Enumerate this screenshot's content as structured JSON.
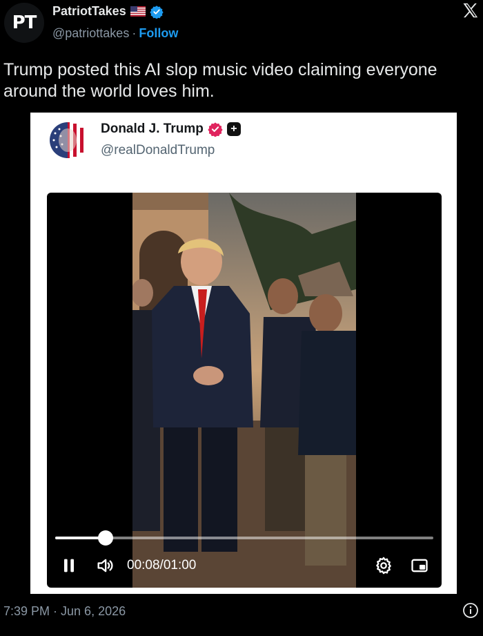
{
  "tweet": {
    "avatar_text": "PT",
    "display_name": "PatriotTakes",
    "handle": "@patriottakes",
    "separator": "·",
    "follow_label": "Follow",
    "text": "Trump posted this AI slop music video claiming everyone around the world loves him.",
    "timestamp": "7:39 PM · Jun 6, 2026"
  },
  "embedded_post": {
    "display_name": "Donald J. Trump",
    "handle": "@realDonaldTrump"
  },
  "video": {
    "current_time": "00:08",
    "time_separator": "/",
    "duration": "01:00",
    "progress": 0.133
  },
  "icons": {
    "flag": "us-flag-icon",
    "verified": "verified-badge-icon",
    "x": "x-logo-icon",
    "pause": "pause-icon",
    "volume": "volume-icon",
    "settings": "gear-icon",
    "pip": "picture-in-picture-icon",
    "info": "info-icon"
  },
  "colors": {
    "background": "#000000",
    "link": "#1d9bf0",
    "verified_blue": "#1d9bf0",
    "verified_pink": "#e0245e",
    "muted_text": "#8b98a5"
  }
}
